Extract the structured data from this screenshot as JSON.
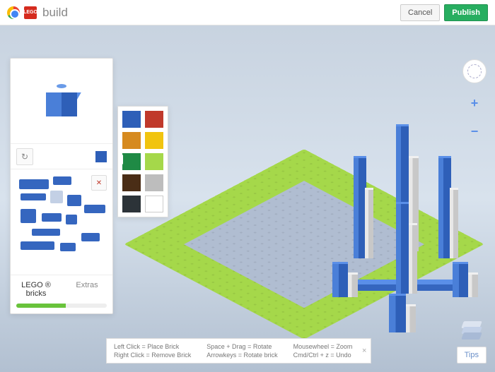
{
  "header": {
    "lego_label": "LEGO",
    "title": "build",
    "cancel": "Cancel",
    "publish": "Publish"
  },
  "panel": {
    "tabs": {
      "bricks": "LEGO ® bricks",
      "extras": "Extras"
    },
    "progress_percent": 55
  },
  "colors": {
    "selected": "#2e5fb8",
    "palette": [
      [
        "#2e5fb8",
        "#c0392b"
      ],
      [
        "#d68a1f",
        "#f1c40f"
      ],
      [
        "#1f8a45",
        "#a5d84a"
      ],
      [
        "#4a2d16",
        "#bdbdbd"
      ],
      [
        "#2c3338",
        "#ffffff"
      ]
    ]
  },
  "zoom": {
    "in": "+",
    "out": "−"
  },
  "help": {
    "left_click": "Left Click = Place Brick",
    "right_click": "Right Click = Remove Brick",
    "space_drag": "Space + Drag = Rotate",
    "arrowkeys": "Arrowkeys = Rotate brick",
    "mousewheel": "Mousewheel = Zoom",
    "undo": "Cmd/Ctrl + z = Undo",
    "close": "×"
  },
  "tips_label": "Tips",
  "icons": {
    "rotate": "↻",
    "delete": "✕"
  }
}
